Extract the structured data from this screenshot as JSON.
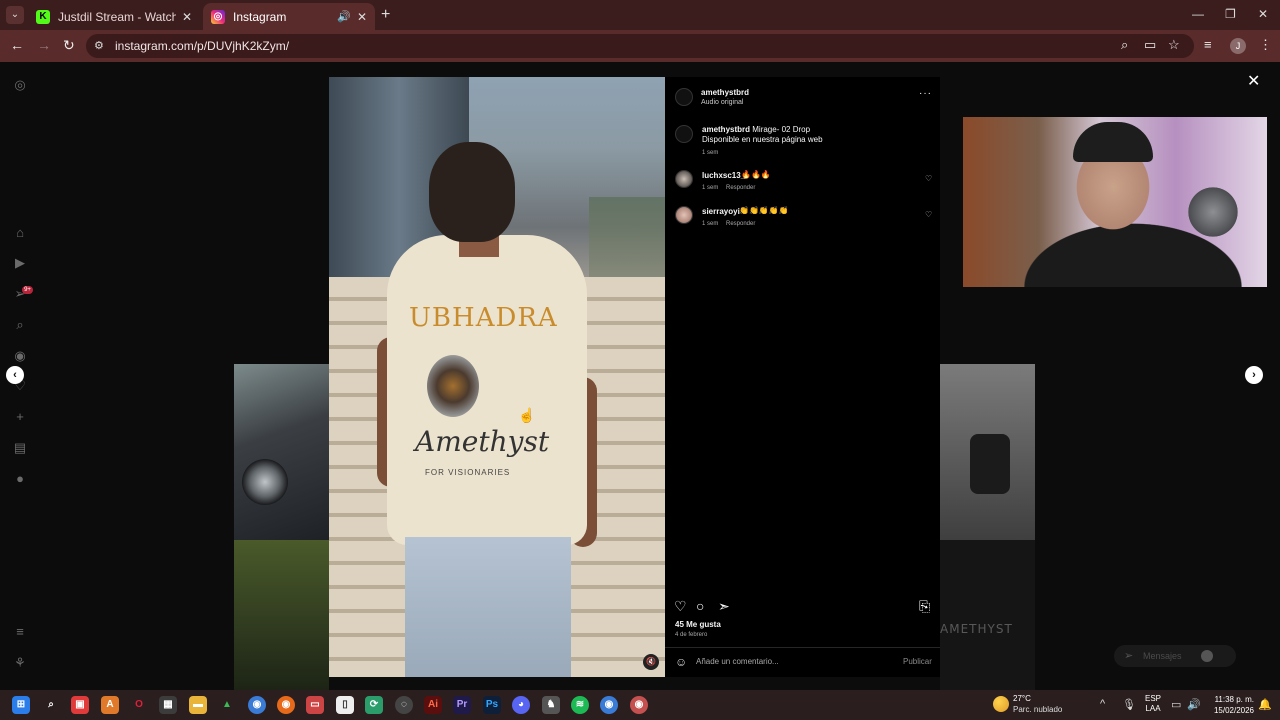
{
  "browser": {
    "tabs": [
      {
        "title": "Justdil Stream - Watch Live on Kick",
        "icon": "kick-icon",
        "active": false
      },
      {
        "title": "Instagram",
        "icon": "instagram-icon",
        "active": true
      }
    ],
    "url": "instagram.com/p/DUVjhK2kZym/",
    "profile_initial": "J"
  },
  "sidebar": {
    "notification_badge": "9+",
    "icons": [
      "instagram-logo-icon",
      "home-icon",
      "reels-icon",
      "direct-icon",
      "search-icon",
      "explore-icon",
      "notifications-icon",
      "create-icon",
      "dashboard-icon",
      "profile-icon",
      "menu-icon",
      "threads-icon"
    ]
  },
  "post": {
    "author": "amethystbrd",
    "audio": "Audio original",
    "caption_user": "amethystbrd",
    "caption_text": "Mirage- 02 Drop",
    "caption_line2": "Disponible en nuestra página web",
    "caption_time": "1 sem",
    "comments": [
      {
        "user": "luchxsc13_",
        "text": "🔥🔥🔥",
        "time": "1 sem",
        "reply": "Responder"
      },
      {
        "user": "sierrayoyi",
        "text": "👏👏👏👏👏",
        "time": "1 sem",
        "reply": "Responder"
      }
    ],
    "likes": "45 Me gusta",
    "date": "4 de febrero",
    "comment_placeholder": "Añade un comentario...",
    "publish_label": "Publicar",
    "shirt_brand": "UBHADRA",
    "shirt_script": "Amethyst",
    "shirt_tag": "FOR VISIONARIES"
  },
  "background": {
    "watermark": "AMETHYST"
  },
  "messages": {
    "label": "Mensajes"
  },
  "taskbar": {
    "weather_temp": "27°C",
    "weather_desc": "Parc. nublado",
    "lang_line1": "ESP",
    "lang_line2": "LAA",
    "time": "11:38 p. m.",
    "date": "15/02/2026"
  }
}
